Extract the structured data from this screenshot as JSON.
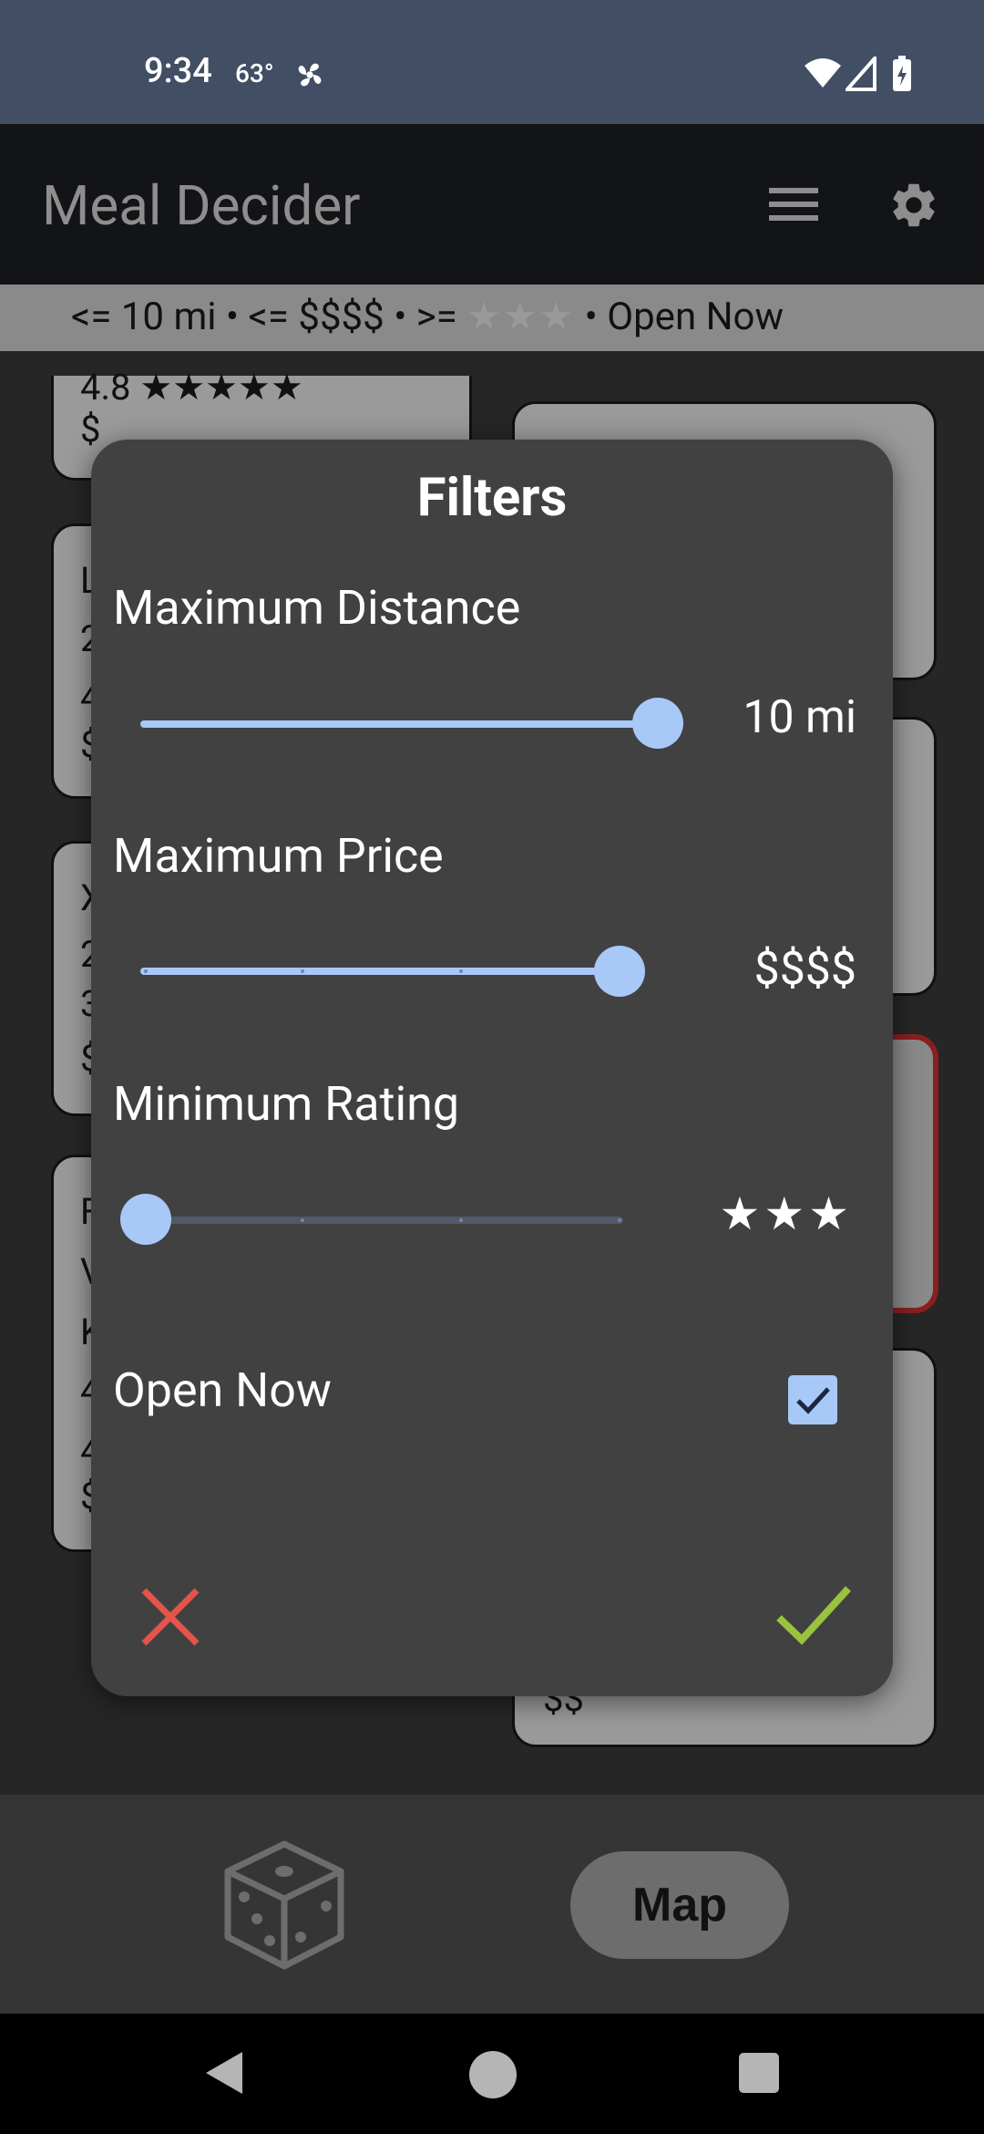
{
  "status_bar": {
    "time": "9:34",
    "temperature": "63°",
    "icons": [
      "fan-icon",
      "wifi-icon",
      "signal-icon",
      "battery-charging-icon"
    ]
  },
  "app_bar": {
    "title": "Meal Decider",
    "menu_icon": "hamburger-menu-icon",
    "settings_icon": "gear-icon"
  },
  "filter_summary": {
    "distance": "<= 10 mi",
    "price": "<= $$$$",
    "rating_prefix": ">=",
    "rating_stars": "★★★",
    "open": "Open Now",
    "separator": "•"
  },
  "background_cards": {
    "card1": {
      "rating": "4.8 ★★★★★",
      "price": "$"
    },
    "card2": {
      "lines": [
        "L",
        "2",
        "4",
        "$"
      ]
    },
    "card3": {
      "lines": [
        "X",
        "2",
        "3",
        "$"
      ]
    },
    "card4": {
      "lines": [
        "F",
        "V",
        "K",
        "4",
        "4",
        "$"
      ]
    },
    "right_card_price": "$$"
  },
  "dialog": {
    "title": "Filters",
    "distance": {
      "label": "Maximum Distance",
      "value": "10 mi",
      "fraction": 1.0
    },
    "price": {
      "label": "Maximum Price",
      "value": "$$$$",
      "level": 4,
      "max": 4
    },
    "rating": {
      "label": "Minimum Rating",
      "value": "★★★",
      "level": 0,
      "max": 3
    },
    "open_now": {
      "label": "Open Now",
      "checked": true
    },
    "cancel_icon": "close-icon",
    "confirm_icon": "checkmark-icon"
  },
  "bottom_bar": {
    "dice_icon": "dice-icon",
    "map_label": "Map"
  },
  "colors": {
    "accent": "#a8c8f8",
    "cancel": "#e3544a",
    "confirm": "#98c33c",
    "dialog_bg": "#414141"
  }
}
